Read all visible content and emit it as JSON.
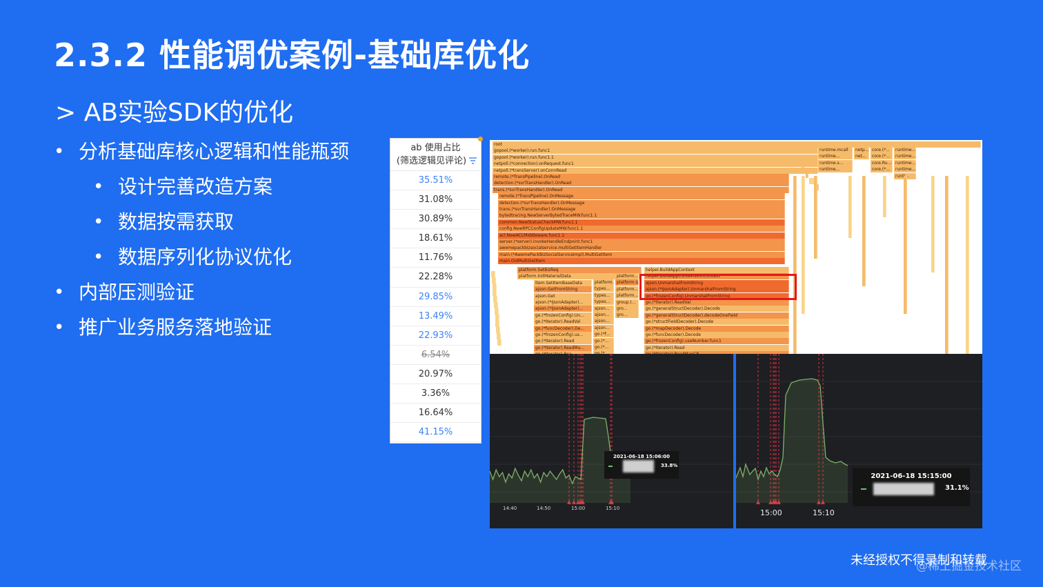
{
  "slide": {
    "title": "2.3.2 性能调优案例-基础库优化",
    "subtitle": "> AB实验SDK的优化",
    "bullets": [
      {
        "text": "分析基础库核心逻辑和性能瓶颈",
        "level": 1
      },
      {
        "text": "设计完善改造方案",
        "level": 2
      },
      {
        "text": "数据按需获取",
        "level": 2
      },
      {
        "text": "数据序列化协议优化",
        "level": 2
      },
      {
        "text": "内部压测验证",
        "level": 1
      },
      {
        "text": "推广业务服务落地验证",
        "level": 1
      }
    ],
    "footer": "未经授权不得录制和转载",
    "watermark": "@稀土掘金技术社区"
  },
  "ab_table": {
    "header_line1": "ab 使用占比",
    "header_line2": "(筛选逻辑见评论)",
    "filter_icon": "filter-icon",
    "rows": [
      {
        "value": "35.51%",
        "style": "blue"
      },
      {
        "value": "31.08%",
        "style": "normal"
      },
      {
        "value": "30.89%",
        "style": "normal"
      },
      {
        "value": "18.61%",
        "style": "normal"
      },
      {
        "value": "11.76%",
        "style": "normal"
      },
      {
        "value": "22.28%",
        "style": "normal"
      },
      {
        "value": "29.85%",
        "style": "blue"
      },
      {
        "value": "13.49%",
        "style": "blue"
      },
      {
        "value": "22.93%",
        "style": "blue"
      },
      {
        "value": "6.54%",
        "style": "strike"
      },
      {
        "value": "20.97%",
        "style": "normal"
      },
      {
        "value": "3.36%",
        "style": "normal"
      },
      {
        "value": "16.64%",
        "style": "normal"
      },
      {
        "value": "41.15%",
        "style": "blue"
      }
    ]
  },
  "flame_graph": {
    "colors": {
      "deep": "#f06a2e",
      "mid": "#f3954a",
      "light": "#f6bb6a",
      "pale": "#f9d48a",
      "highlight_box": "#e11919"
    },
    "frames": [
      {
        "label": "root",
        "tone": "light"
      },
      {
        "label": "gopool.(*worker).run.func1",
        "tone": "light"
      },
      {
        "label": "gopool.(*worker).run.func1.1",
        "tone": "light"
      },
      {
        "label": "netpoll.(*connection).onRequest.func1",
        "tone": "light"
      },
      {
        "label": "netpoll.(*transServer).onConnRead",
        "tone": "light"
      },
      {
        "label": "remote.(*TransPipeline).OnRead",
        "tone": "mid"
      },
      {
        "label": "detection.(*svrTransHandler).OnRead",
        "tone": "mid"
      },
      {
        "label": "trans.(*svrTransHandler).OnRead",
        "tone": "mid"
      },
      {
        "label": "remote.(*TransPipeline).OnMessage",
        "tone": "mid"
      },
      {
        "label": "detection.(*svrTransHandler).OnMessage",
        "tone": "mid"
      },
      {
        "label": "trans.(*svrTransHandler).OnMessage",
        "tone": "mid"
      },
      {
        "label": "bytedtracing.NewServerBytedTraceMW.func1.1",
        "tone": "mid"
      },
      {
        "label": "common.NewStatusCheckMW.func1.1",
        "tone": "deep"
      },
      {
        "label": "config.NewRPCConfigUpdateMW.func1.1",
        "tone": "mid"
      },
      {
        "label": "acl.NewACLMiddleware.func1.1",
        "tone": "deep"
      },
      {
        "label": "server.(*server).invokeHandleEndpoint.func1",
        "tone": "mid"
      },
      {
        "label": "awemepackbizsocialservice.multiGetItemHandler",
        "tone": "mid"
      },
      {
        "label": "main.(*AwemePackBizSocialServiceImpl).MultiGetItem",
        "tone": "mid"
      },
      {
        "label": "main.OidMultiGetItem",
        "tone": "deep"
      }
    ],
    "left_stack": [
      "platform.SetBizReq",
      "platform.InitMaterialData",
      "item.SetItemBaseData",
      "ajson.GetFromString",
      "ajson.Get",
      "ajson.(*IJsonAdapter)...",
      "ajson.(*IJsonAdapter)...",
      "go.(*frozenConfig).Un...",
      "go.(*Iterator).ReadVal",
      "go.(*funcDecoder).De...",
      "go.(*frozenConfig).us...",
      "go.(*Iterator).Read",
      "go.(*Iterator).ReadMa...",
      "go.(*Iterator).Rea..."
    ],
    "middle_stack": [
      "platform...",
      "types...",
      "types...",
      "types...",
      "ajson...",
      "ajson...",
      "ajson...",
      "ajson...",
      "go.(*f...",
      "go.(*...",
      "go.(*...",
      "go.(*..."
    ],
    "right_stack": [
      "helper.BuildAppContext",
      "helper.BuildAppContextWithContext",
      "ajson.UnmarshalFromString",
      "ajson.(*IJsonAdapter).UnmarshalFromString",
      "go.(*frozenConfig).UnmarshalFromString",
      "go.(*Iterator).ReadVal",
      "go.(*generalStructDecoder).Decode",
      "go.(*generalStructDecoder).decodeOneField",
      "go.(*structFieldDecoder).Decode",
      "go.(*mapDecoder).Decode",
      "go.(*funcDecoder).Decode",
      "go.(*frozenConfig).useNumber.func1",
      "go.(*Iterator).Read",
      "go.(*Iterator).ReadMapCB"
    ],
    "plat_col": [
      "platform...",
      "platform.U...",
      "platform...",
      "platform...",
      "group.(...",
      "gro...",
      "gro..."
    ],
    "top_right": [
      [
        "runtime.mcall",
        "netp...",
        "core.(*...",
        "runtime..."
      ],
      [
        "runtime...",
        "net...",
        "core.(*...",
        "runtime..."
      ],
      [
        "runtime.s...",
        "",
        "core.Ru...",
        "runtime..."
      ],
      [
        "runtime...",
        "",
        "core.(*...",
        "runtime..."
      ],
      [
        "",
        "",
        "",
        "runti..."
      ]
    ]
  },
  "monitor_left": {
    "line_color": "#7eb26d",
    "marker_color": "#e02f44",
    "x_ticks": [
      "14:40",
      "14:50",
      "15:00",
      "15:10"
    ],
    "tooltip_time": "2021-06-18 15:06:00",
    "tooltip_value": "33.8%"
  },
  "monitor_right": {
    "line_color": "#7eb26d",
    "marker_color": "#e02f44",
    "x_ticks": [
      "15:00",
      "15:10"
    ],
    "tooltip_time": "2021-06-18 15:15:00",
    "tooltip_value": "31.1%"
  }
}
